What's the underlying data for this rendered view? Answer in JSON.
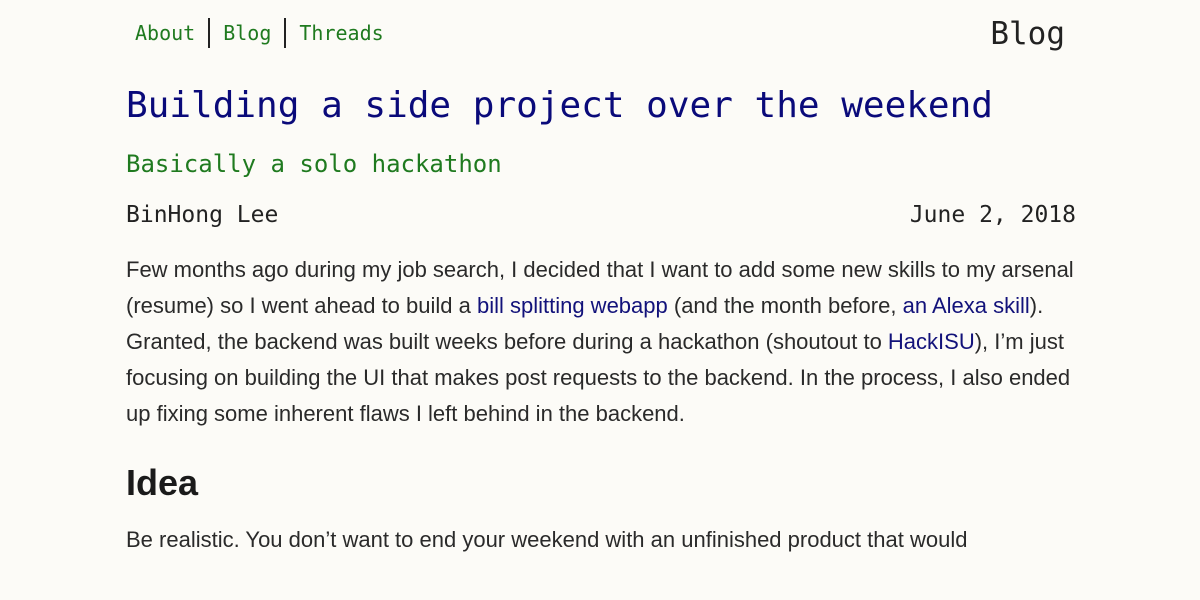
{
  "nav": {
    "items": [
      {
        "label": "About"
      },
      {
        "label": "Blog"
      },
      {
        "label": "Threads"
      }
    ]
  },
  "section_label": "Blog",
  "post": {
    "title": "Building a side project over the weekend",
    "subtitle": "Basically a solo hackathon",
    "author": "BinHong Lee",
    "date": "June 2, 2018"
  },
  "intro": {
    "t1": "Few months ago during my job search, I decided that I want to add some new skills to my arsenal (resume) so I went ahead to build a ",
    "link1": "bill splitting webapp",
    "t2": " (and the month before, ",
    "link2": "an Alexa skill",
    "t3": "). Granted, the backend was built weeks before during a hackathon (shoutout to ",
    "link3": "HackISU",
    "t4": "), I’m just focusing on building the UI that makes post requests to the backend. In the process, I also ended up fixing some inherent flaws I left behind in the backend."
  },
  "idea": {
    "heading": "Idea",
    "text": "Be realistic. You don’t want to end your weekend with an unfinished product that would"
  }
}
